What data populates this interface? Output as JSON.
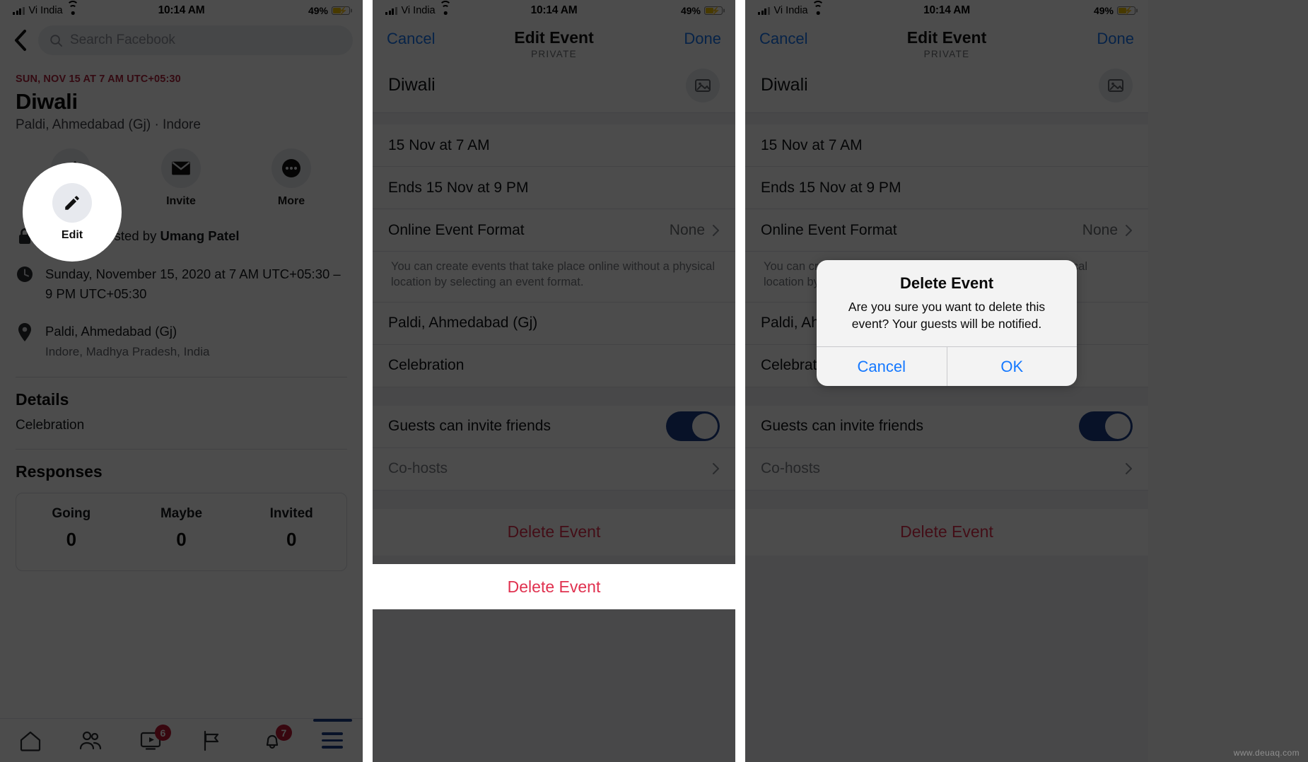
{
  "status_bar": {
    "carrier": "Vi India",
    "time": "10:14 AM",
    "battery_pct": "49%",
    "signal_icon": "cellular-bars-icon",
    "wifi_icon": "wifi-icon",
    "battery_icon": "battery-charging-icon"
  },
  "colors": {
    "facebook_blue": "#1877f2",
    "nav_blue": "#1d3f86",
    "event_date_red": "#b0243c",
    "destructive_red": "#e0314f",
    "badge_red": "#bb1a33",
    "alert_blue": "#1478ff",
    "battery_yellow": "#f2c200"
  },
  "panel1": {
    "name": "facebook-event-details",
    "nav": {
      "back_icon": "back-chevron-icon",
      "search_icon": "search-icon",
      "search_placeholder": "Search Facebook"
    },
    "event": {
      "date_line": "SUN, NOV 15 AT 7 AM UTC+05:30",
      "title": "Diwali",
      "subtitle": "Paldi, Ahmedabad (Gj) · Indore"
    },
    "actions": [
      {
        "label": "Edit",
        "icon": "pencil-icon"
      },
      {
        "label": "Invite",
        "icon": "envelope-icon"
      },
      {
        "label": "More",
        "icon": "ellipsis-icon"
      }
    ],
    "meta": [
      {
        "icon": "lock-icon",
        "text_before": "Private · Hosted by ",
        "host": "Umang Patel",
        "sub": ""
      },
      {
        "icon": "clock-icon",
        "text_before": "Sunday, November 15, 2020 at 7 AM UTC+05:30 – 9 PM UTC+05:30",
        "host": "",
        "sub": ""
      },
      {
        "icon": "location-pin-icon",
        "text_before": "Paldi, Ahmedabad (Gj)",
        "host": "",
        "sub": "Indore, Madhya Pradesh, India"
      }
    ],
    "details": {
      "heading": "Details",
      "body": "Celebration"
    },
    "responses": {
      "heading": "Responses",
      "columns": [
        "Going",
        "Maybe",
        "Invited"
      ],
      "values": [
        "0",
        "0",
        "0"
      ]
    },
    "tabbar": [
      {
        "icon": "home-icon",
        "badge": ""
      },
      {
        "icon": "friends-icon",
        "badge": ""
      },
      {
        "icon": "watch-video-icon",
        "badge": "6"
      },
      {
        "icon": "marketplace-flag-icon",
        "badge": ""
      },
      {
        "icon": "notifications-bell-icon",
        "badge": "7"
      },
      {
        "icon": "menu-hamburger-icon",
        "badge": ""
      }
    ],
    "spotlight": {
      "label": "Edit",
      "icon": "pencil-icon"
    }
  },
  "panel2": {
    "name": "edit-event-form",
    "header": {
      "cancel": "Cancel",
      "title": "Edit Event",
      "privacy": "PRIVATE",
      "done": "Done"
    },
    "rows": [
      {
        "label": "Diwali",
        "value": "",
        "type": "event-name",
        "trailing": "photo-icon"
      },
      {
        "label": "15 Nov at 7 AM",
        "value": "",
        "type": "start-date",
        "trailing": ""
      },
      {
        "label": "Ends 15 Nov at 9 PM",
        "value": "",
        "type": "end-date",
        "trailing": ""
      },
      {
        "label": "Online Event Format",
        "value": "None",
        "type": "online-format",
        "trailing": "chevron-right-icon"
      }
    ],
    "note": "You can create events that take place online without a physical location by selecting an event format.",
    "rows2": [
      {
        "label": "Paldi, Ahmedabad (Gj)",
        "value": "",
        "type": "location",
        "trailing": ""
      },
      {
        "label": "Celebration",
        "value": "",
        "type": "description",
        "trailing": ""
      }
    ],
    "rows3": [
      {
        "label": "Guests can invite friends",
        "value": "on",
        "type": "toggle",
        "trailing": "toggle-switch"
      },
      {
        "label": "Co-hosts",
        "value": "",
        "type": "co-hosts",
        "trailing": "chevron-right-icon"
      }
    ],
    "delete_label": "Delete Event",
    "spotlight": {
      "label": "Delete Event"
    }
  },
  "panel3": {
    "name": "delete-event-confirm",
    "alert": {
      "title": "Delete Event",
      "message": "Are you sure you want to delete this event? Your guests will be notified.",
      "cancel": "Cancel",
      "ok": "OK"
    }
  },
  "watermark": "www.deuaq.com"
}
